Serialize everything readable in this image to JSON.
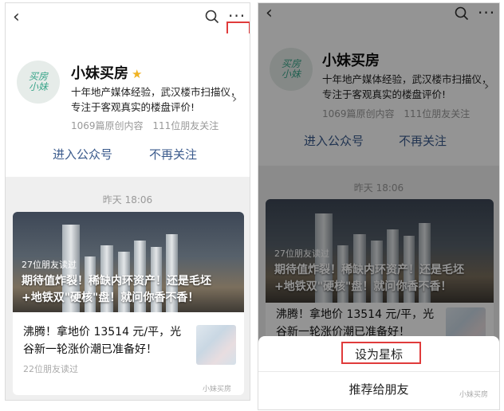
{
  "account": {
    "name": "小妹买房",
    "avatar_text_1": "买房",
    "avatar_text_2": "小妹",
    "description_line1": "十年地产媒体经验，武汉楼市扫描仪，",
    "description_line2": "专注于客观真实的楼盘评价!",
    "original_count": "1069篇原创内容",
    "friends_following": "111位朋友关注"
  },
  "actions": {
    "enter": "进入公众号",
    "unfollow": "不再关注"
  },
  "feed": {
    "timestamp": "昨天 18:06",
    "hero": {
      "readers": "27位朋友读过",
      "title_line1": "期待值炸裂！稀缺内环资产！还是毛坯",
      "title_line2": "+地铁双\"硬核\"盘！就问你香不香！"
    },
    "article": {
      "title_line1": "沸腾！拿地价 13514 元/平，光",
      "title_line2": "谷新一轮涨价潮已准备好！",
      "readers": "22位朋友读过"
    },
    "watermark": "小妹买房"
  },
  "sheet": {
    "set_star": "设为星标",
    "recommend": "推荐给朋友"
  },
  "icons": {
    "back": "‹",
    "more": "···",
    "star": "★",
    "chevron": "›"
  },
  "colors": {
    "link_blue": "#3a5a8c",
    "highlight_red": "#e03b3b",
    "star_gold": "#f0b323"
  }
}
